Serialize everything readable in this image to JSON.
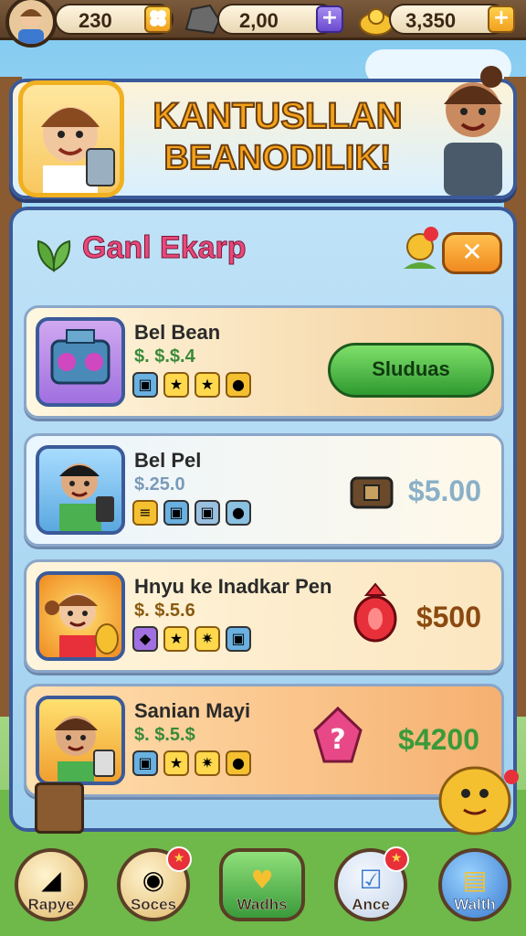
{
  "top_bar": {
    "coins": "230",
    "stones": "2,00",
    "gems": "3,350",
    "plus": "+"
  },
  "banner": {
    "title_line1": "KANTUSLLAN",
    "title_line2": "BEANODILIK!"
  },
  "panel": {
    "title": "Ganl Ekarp",
    "close": "✕"
  },
  "items": [
    {
      "name": "Bel Bean",
      "sub": "$. $.$.4",
      "action": "Sluduas"
    },
    {
      "name": "Bel Pel",
      "sub": "$.25.0",
      "price": "$5.00"
    },
    {
      "name": "Hnyu ke Inadkar Pen",
      "sub": "$. $.5.6",
      "price": "$500"
    },
    {
      "name": "Sanian Mayi",
      "sub": "$. $.5.$",
      "price": "$4200"
    }
  ],
  "nav": [
    {
      "label": "Rapye"
    },
    {
      "label": "Soces"
    },
    {
      "label": "Wadhs"
    },
    {
      "label": "Ance"
    },
    {
      "label": "Walth"
    }
  ],
  "colors": {
    "panel_border": "#3b5a9a",
    "title_pink": "#e8487a",
    "price_green": "#3a9a3a",
    "price_brown": "#8a4a10",
    "price_blue": "#8ab0c8"
  }
}
